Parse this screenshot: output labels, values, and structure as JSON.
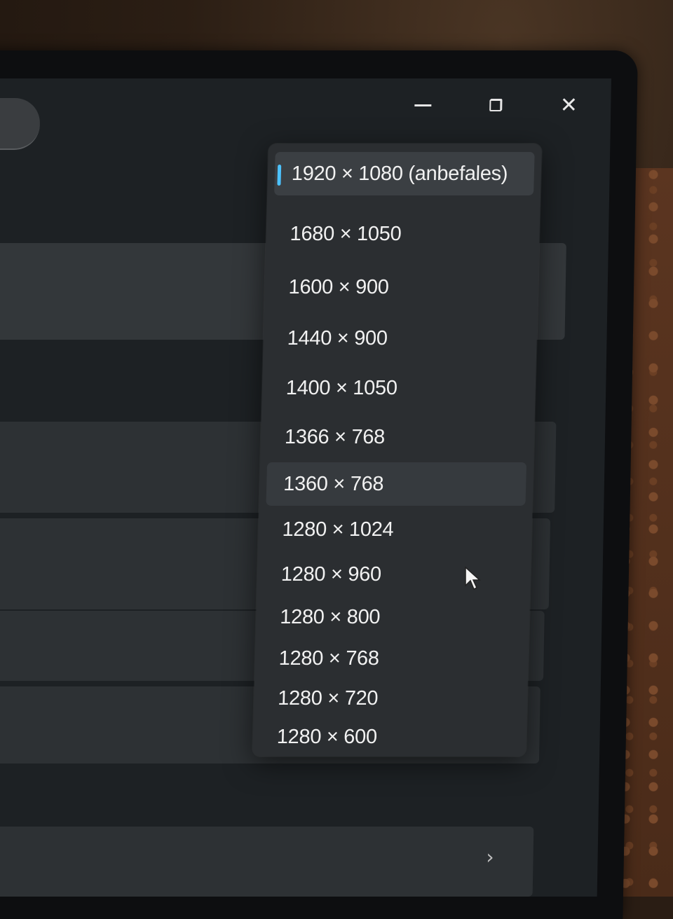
{
  "window": {
    "controls": {
      "minimize": "minimize-icon",
      "restore": "restore-icon",
      "close": "close-icon"
    },
    "close_glyph": "✕"
  },
  "resolution_dropdown": {
    "accent_color": "#4cc2ff",
    "selected_index": 0,
    "hover_index": 6,
    "options": [
      {
        "label": "1920 × 1080 (anbefales)"
      },
      {
        "label": "1680 × 1050"
      },
      {
        "label": "1600 × 900"
      },
      {
        "label": "1440 × 900"
      },
      {
        "label": "1400 × 1050"
      },
      {
        "label": "1366 × 768"
      },
      {
        "label": "1360 × 768"
      },
      {
        "label": "1280 × 1024"
      },
      {
        "label": "1280 × 960"
      },
      {
        "label": "1280 × 800"
      },
      {
        "label": "1280 × 768"
      },
      {
        "label": "1280 × 720"
      },
      {
        "label": "1280 × 600"
      }
    ]
  },
  "footer": {
    "chevron": "›"
  }
}
